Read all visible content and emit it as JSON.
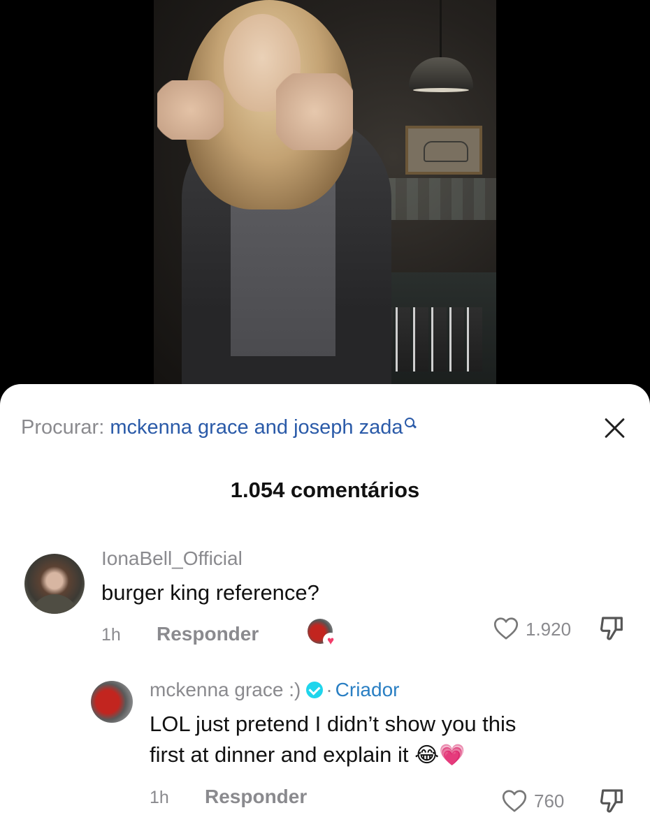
{
  "search": {
    "prefix": "Procurar:",
    "query": "mckenna grace and joseph zada"
  },
  "comments_header": {
    "count_label": "1.054 comentários"
  },
  "comments": [
    {
      "username": "IonaBell_Official",
      "text": "burger king reference?",
      "time": "1h",
      "reply_label": "Responder",
      "likes": "1.920"
    }
  ],
  "reply": {
    "username": "mckenna grace :)",
    "separator": "·",
    "badge": "Criador",
    "text_line1": "LOL just pretend I didn’t show you this",
    "text_line2": "first at dinner and explain it",
    "emoji": "😂💗",
    "time": "1h",
    "reply_label": "Responder",
    "likes": "760"
  },
  "icons": {
    "search": "search-icon",
    "close": "close-icon",
    "like": "heart-outline-icon",
    "dislike": "thumbs-down-icon",
    "verified": "verified-icon",
    "creator_liked": "creator-liked-heart-icon"
  },
  "colors": {
    "query_link": "#2a5aa8",
    "creator_badge": "#2a7fc3",
    "verified": "#20d5ec",
    "muted_text": "#8a8a8e"
  }
}
